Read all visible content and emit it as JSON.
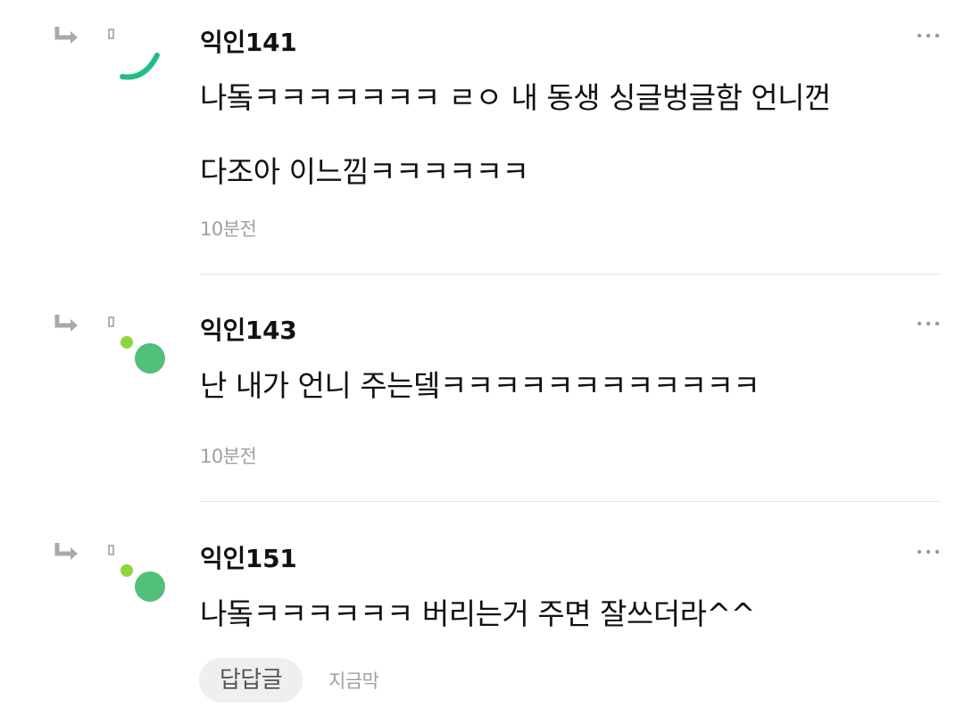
{
  "comments": [
    {
      "nickname": "익인141",
      "lines": [
        "나돜ㅋㅋㅋㅋㅋㅋㅋ ㄹㅇ 내 동생 싱글벙글함 언니껀",
        "다조아 이느낌ㅋㅋㅋㅋㅋㅋ"
      ],
      "time": "10분전",
      "avatar_color": "#1fbf82",
      "avatar_style": "arc"
    },
    {
      "nickname": "익인143",
      "lines": [
        "난 내가 언니 주는뎈ㅋㅋㅋㅋㅋㅋㅋㅋㅋㅋㅋㅋ"
      ],
      "time": "10분전",
      "avatar_color": "#52c07a",
      "dot_color": "#8fd63d",
      "avatar_style": "dots"
    },
    {
      "nickname": "익인151",
      "lines": [
        "나돜ㅋㅋㅋㅋㅋㅋ 버리는거 주면 잘쓰더라^^"
      ],
      "reply_button": "답답글",
      "time": "지금막",
      "avatar_color": "#52c07a",
      "dot_color": "#8fd63d",
      "avatar_style": "dots"
    }
  ],
  "icons": {
    "reply_indicator": "reply-arrow-icon",
    "more_menu": "more-horizontal-icon"
  },
  "colors": {
    "text": "#111111",
    "meta": "#a0a0a0",
    "divider": "#e6e6e6",
    "reply_button_bg": "#efefef"
  }
}
